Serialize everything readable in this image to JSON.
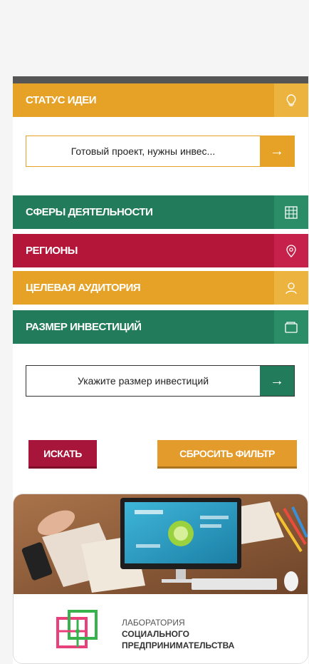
{
  "filters": {
    "status": {
      "title": "СТАТУС ИДЕИ",
      "icon": "lightbulb-icon"
    },
    "status_select": {
      "value": "Готовый проект, нужны инвес...",
      "arrow": "→"
    },
    "spheres": {
      "title": "СФЕРЫ ДЕЯТЕЛЬНОСТИ",
      "icon": "building-icon"
    },
    "regions": {
      "title": "РЕГИОНЫ",
      "icon": "map-pin-icon"
    },
    "audience": {
      "title": "ЦЕЛЕВАЯ АУДИТОРИЯ",
      "icon": "user-icon"
    },
    "investment": {
      "title": "РАЗМЕР ИНВЕСТИЦИЙ",
      "icon": "wallet-icon"
    },
    "investment_select": {
      "value": "Укажите размер инвестиций",
      "arrow": "→"
    }
  },
  "buttons": {
    "search": "ИСКАТЬ",
    "reset": "СБРОСИТЬ ФИЛЬТР"
  },
  "banner": {
    "logo_line1": "ЛАБОРАТОРИЯ",
    "logo_line2": "СОЦИАЛЬНОГО",
    "logo_line3": "ПРЕДПРИНИМАТЕЛЬСТВА"
  },
  "colors": {
    "orange": "#e6a226",
    "green": "#227b5a",
    "red": "#b4163a",
    "search_button": "#a8153a",
    "reset_button": "#e39b2b"
  }
}
